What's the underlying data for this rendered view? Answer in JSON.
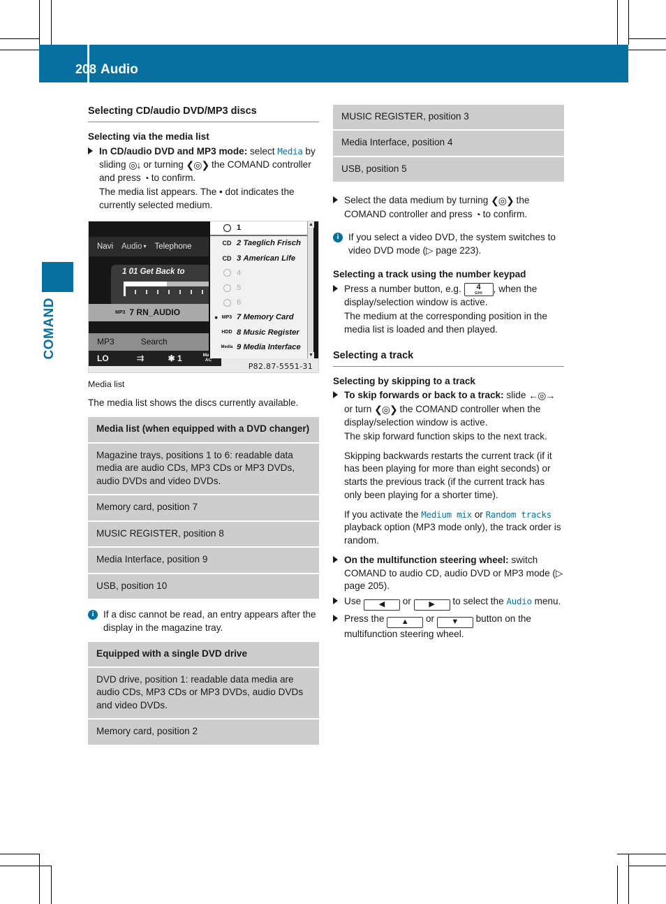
{
  "header": {
    "page_number": "208",
    "chapter_title": "Audio",
    "accent_color": "#0870a0"
  },
  "side_tab": {
    "label": "COMAND"
  },
  "left_column": {
    "section_title": "Selecting CD/audio DVD/MP3 discs",
    "sub1_title": "Selecting via the media list",
    "step1": {
      "bold_lead": "In CD/audio DVD and MP3 mode:",
      "text_a": " select ",
      "mono_media": "Media",
      "text_b": " by sliding ",
      "ctrl_slide": "◎↓",
      "text_c": " or turning ",
      "ctrl_turn": "❮◎❯",
      "text_d": " the COMAND controller and press ",
      "ctrl_press": "◔",
      "text_e": " to confirm."
    },
    "step1_result": "The media list appears. The  •  dot indicates the currently selected medium.",
    "image_caption": "Media list",
    "body1": "The media list shows the discs currently available.",
    "table1": {
      "header": "Media list (when equipped with a DVD changer)",
      "rows": [
        "Magazine trays, positions 1 to 6: readable data media are audio CDs, MP3 CDs or MP3 DVDs, audio DVDs and video DVDs.",
        "Memory card, position 7",
        "MUSIC REGISTER, position 8",
        "Media Interface, position 9",
        "USB, position 10"
      ]
    },
    "note1": "If a disc cannot be read, an entry appears after the display in the magazine tray.",
    "table2": {
      "header": "Equipped with a single DVD drive",
      "rows": [
        "DVD drive, position 1: readable data media are audio CDs, MP3 CDs or MP3 DVDs, audio DVDs and video DVDs.",
        "Memory card, position 2"
      ]
    }
  },
  "comand_screen": {
    "menu_tabs": [
      "Navi",
      "Audio",
      "Telephone"
    ],
    "now_playing": "1 01 Get Back to",
    "selected_row": {
      "icon": "MP3",
      "label": "7 RN_AUDIO"
    },
    "soft_buttons": [
      "MP3",
      "Search"
    ],
    "status": {
      "lo": "LO",
      "repeat_icon": "⇉",
      "mix": "✱ 1",
      "max": "Max\nAC"
    },
    "media_list": [
      {
        "pos": "1",
        "name": "",
        "icon": "disc",
        "state": "active",
        "selected": false
      },
      {
        "pos": "2",
        "name": "Taeglich Frisch",
        "icon": "CD",
        "state": "loaded",
        "selected": false
      },
      {
        "pos": "3",
        "name": "American Life",
        "icon": "CD",
        "state": "loaded",
        "selected": false
      },
      {
        "pos": "4",
        "name": "",
        "icon": "empty",
        "state": "empty",
        "selected": false
      },
      {
        "pos": "5",
        "name": "",
        "icon": "empty",
        "state": "empty",
        "selected": false
      },
      {
        "pos": "6",
        "name": "",
        "icon": "empty",
        "state": "empty",
        "selected": false
      },
      {
        "pos": "7",
        "name": "Memory Card",
        "icon": "MP3",
        "state": "loaded",
        "selected": true
      },
      {
        "pos": "8",
        "name": "Music Register",
        "icon": "HDD",
        "state": "loaded",
        "selected": false
      },
      {
        "pos": "9",
        "name": "Media Interface",
        "icon": "Media",
        "state": "loaded",
        "selected": false
      }
    ],
    "figure_id": "P82.87-5551-31"
  },
  "right_column": {
    "table_cont_rows": [
      "MUSIC REGISTER, position 3",
      "Media Interface, position 4",
      "USB, position 5"
    ],
    "step_select": {
      "text_a": "Select the data medium by turning ",
      "ctrl_turn": "❮◎❯",
      "text_b": " the COMAND controller and press ",
      "ctrl_press": "◔",
      "text_c": " to confirm."
    },
    "note_video": "If you select a video DVD, the system switches to video DVD mode (▷ page 223).",
    "sub_keypad_title": "Selecting a track using the number keypad",
    "step_keypad": {
      "text_a": "Press a number button, e.g. ",
      "key_number": "4",
      "key_letters": "GHI",
      "text_b": ", when the display/selection window is active."
    },
    "step_keypad_result": "The medium at the corresponding position in the media list is loaded and then played.",
    "section_track_title": "Selecting a track",
    "sub_skip_title": "Selecting by skipping to a track",
    "step_skip": {
      "bold_lead": "To skip forwards or back to a track:",
      "text_a": " slide ",
      "ctrl_slide": "←◎→",
      "text_b": " or turn ",
      "ctrl_turn": "❮◎❯",
      "text_c": " the COMAND controller when the display/selection window is active."
    },
    "skip_fwd_text": "The skip forward function skips to the next track.",
    "skip_back_text": "Skipping backwards restarts the current track (if it has been playing for more than eight seconds) or starts the previous track (if the current track has only been playing for a shorter time).",
    "random_text": {
      "text_a": "If you activate the ",
      "mono_a": "Medium mix",
      "text_b": " or ",
      "mono_b": "Random tracks",
      "text_c": " playback option (MP3 mode only), the track order is random."
    },
    "step_mfsw": {
      "bold_lead": "On the multifunction steering wheel:",
      "text_a": " switch COMAND to audio CD, audio DVD or MP3 mode (▷ page 205)."
    },
    "step_use": {
      "text_a": "Use ",
      "key_left": "◀",
      "text_b": " or ",
      "key_right": "▶",
      "text_c": " to select the ",
      "mono_audio": "Audio",
      "text_d": " menu."
    },
    "step_press": {
      "text_a": "Press the ",
      "key_up": "▲",
      "text_b": " or ",
      "key_down": "▼",
      "text_c": " button on the multifunction steering wheel."
    }
  }
}
